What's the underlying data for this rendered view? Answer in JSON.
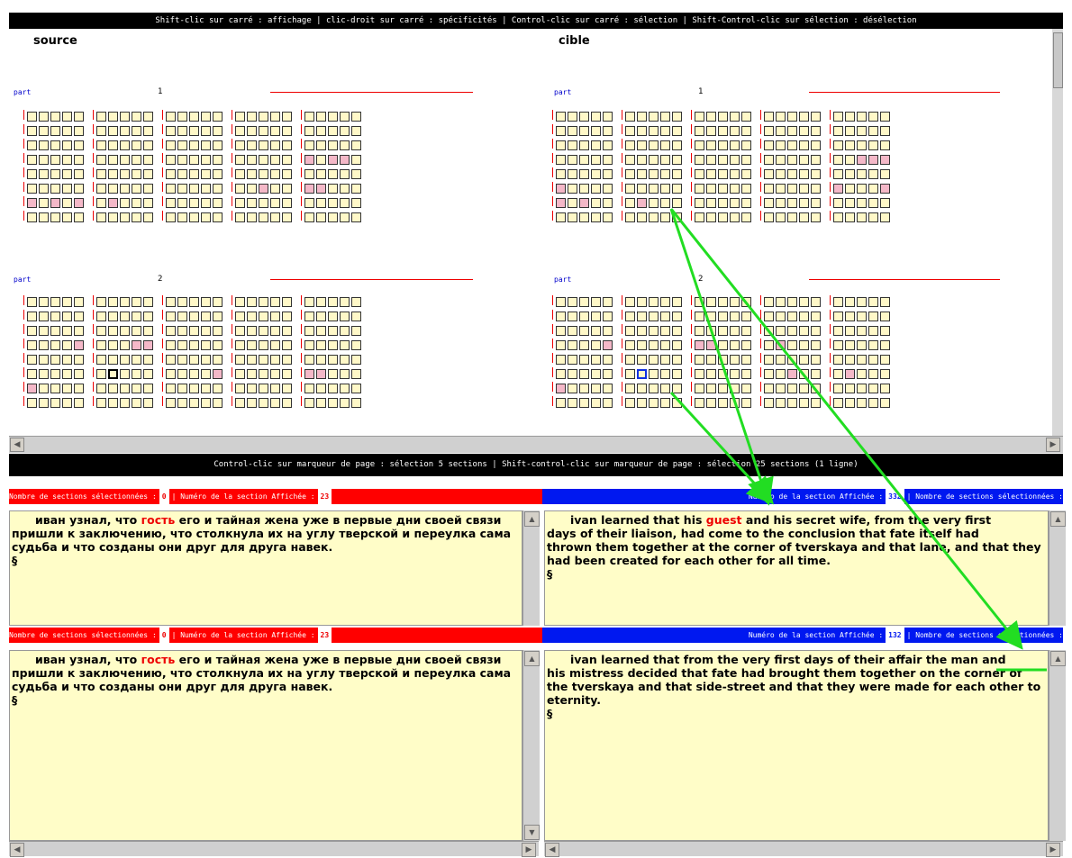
{
  "top_instructions": "Shift-clic sur carré : affichage | clic-droit sur carré : spécificités | Control-clic sur carré : sélection | Shift-Control-clic sur sélection : désélection",
  "source_label": "source",
  "target_label": "cible",
  "part_label": "part",
  "part_numbers": [
    "1",
    "2"
  ],
  "mid_instructions": "Control-clic sur marqueur de page : sélection 5 sections | Shift-control-clic sur marqueur de page : sélection 25 sections (1 ligne)",
  "row1": {
    "left_label_a": "Nombre de sections sélectionnées :",
    "left_count": "0",
    "left_label_b": "| Numéro de la section Affichée :",
    "left_section": "23",
    "right_label_a": "Numéro de la section Affichée :",
    "right_section": "332",
    "right_label_b": "| Nombre de sections sélectionnées :",
    "source_text": [
      "иван узнал,  что ",
      "гость",
      " его и тайная жена  уже в первые  дни своей связи",
      "пришли  к заключению,  что  столкнула их  на  углу тверской и переулка сама",
      "судьба и что созданы они друг для друга навек.",
      "§"
    ],
    "target_text": [
      "ivan learned  that his ",
      "guest",
      "  and his secret wife,  from the very first",
      "days  of  their liaison, had come  to the  conclusion that  fate itself had",
      "thrown them together at the corner of tverskaya and that lane, and that they",
      "had been created for each other for all time.",
      "§"
    ]
  },
  "row2": {
    "left_label_a": "Nombre de sections sélectionnées :",
    "left_count": "0",
    "left_label_b": "| Numéro de la section Affichée :",
    "left_section": "23",
    "right_label_a": "Numéro de la section Affichée :",
    "right_section": "132",
    "right_label_b": "| Nombre de sections sélectionnées :",
    "source_text": [
      "иван узнал,  что ",
      "гость",
      " его и тайная жена  уже в первые  дни своей связи",
      "пришли  к заключению,  что  столкнула их  на  углу тверской и переулка сама",
      "судьба и что созданы они друг для друга навек.",
      "§"
    ],
    "target_text": [
      "ivan  learned that from the very first days of their affair the man and",
      "his mistress decided that fate had brought them together on  the corner  of",
      "the tverskaya and that side-street and that they were made for each other to",
      "eternity.",
      "§"
    ]
  },
  "colors": {
    "accent_red": "#ff0000",
    "accent_blue": "#0018f0",
    "arrow_green": "#22dd22",
    "cell_pink": "#f4b8c8",
    "cell_fill": "#fff8c8"
  },
  "grids": {
    "source_1": [
      "00001000001000110000010001",
      "00001101010000101010100001",
      "10000100001000011011010000",
      "10100100111011010000100010",
      "00001000001000100001100000",
      "00001011000100010001011000",
      "00000100000000000000000000",
      "00000000000000100011101001"
    ],
    "source_1_pink": [
      [
        5,
        0
      ],
      [
        5,
        5
      ],
      [
        7,
        0
      ],
      [
        7,
        2
      ],
      [
        7,
        3
      ],
      [
        9,
        0
      ],
      [
        5,
        7
      ],
      [
        5,
        20
      ],
      [
        5,
        16
      ],
      [
        6,
        0
      ],
      [
        6,
        1
      ],
      [
        6,
        2
      ],
      [
        6,
        4
      ]
    ],
    "target_1": [
      "01001001100001100000000001",
      "00001101010000101010100001",
      "10000100000000011011010000",
      "10000100111011010000100010",
      "00001000000000100001100000",
      "00001010000100010001011000",
      "00000100000000000000000000",
      "00000000000000100011101001"
    ],
    "source_2": [
      "00001001100001100000000001",
      "00001101010000101010100001",
      "10000100000000011011010000",
      "10000100111011010000100010",
      "00001000001000100001100000",
      "00000101000100010001011000",
      "00000000000000000000000000",
      "00000000000000100011101001"
    ],
    "target_2": [
      "01001001100001100000000001",
      "01001101010000101010100001",
      "10000100000000011011010000",
      "10000100110010010000100010",
      "00001000000000100001100000",
      "00000101000100010001011000",
      "00000000000000000000000000",
      "00000000000000100011101001"
    ]
  }
}
